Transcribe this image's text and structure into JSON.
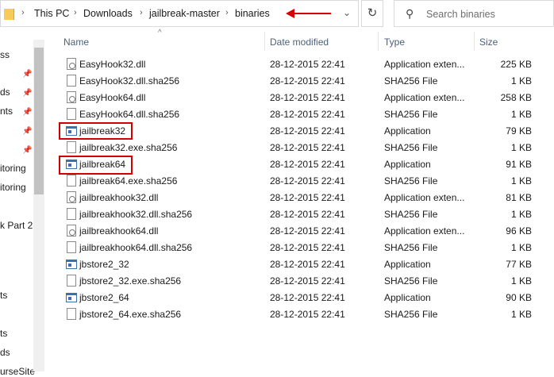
{
  "address": {
    "segments": [
      "This PC",
      "Downloads",
      "jailbreak-master",
      "binaries"
    ]
  },
  "search": {
    "placeholder": "Search binaries"
  },
  "nav": {
    "items": [
      "ss",
      "ds",
      "nts",
      "itoring",
      "itoring",
      "k Part 2",
      "ts",
      "ts",
      "ds",
      "urseSite"
    ]
  },
  "columns": {
    "name": "Name",
    "date": "Date modified",
    "type": "Type",
    "size": "Size"
  },
  "files": [
    {
      "name": "EasyHook32.dll",
      "date": "28-12-2015 22:41",
      "type": "Application exten...",
      "size": "225 KB",
      "icon": "dll"
    },
    {
      "name": "EasyHook32.dll.sha256",
      "date": "28-12-2015 22:41",
      "type": "SHA256 File",
      "size": "1 KB",
      "icon": "file"
    },
    {
      "name": "EasyHook64.dll",
      "date": "28-12-2015 22:41",
      "type": "Application exten...",
      "size": "258 KB",
      "icon": "dll"
    },
    {
      "name": "EasyHook64.dll.sha256",
      "date": "28-12-2015 22:41",
      "type": "SHA256 File",
      "size": "1 KB",
      "icon": "file"
    },
    {
      "name": "jailbreak32",
      "date": "28-12-2015 22:41",
      "type": "Application",
      "size": "79 KB",
      "icon": "app"
    },
    {
      "name": "jailbreak32.exe.sha256",
      "date": "28-12-2015 22:41",
      "type": "SHA256 File",
      "size": "1 KB",
      "icon": "file"
    },
    {
      "name": "jailbreak64",
      "date": "28-12-2015 22:41",
      "type": "Application",
      "size": "91 KB",
      "icon": "app"
    },
    {
      "name": "jailbreak64.exe.sha256",
      "date": "28-12-2015 22:41",
      "type": "SHA256 File",
      "size": "1 KB",
      "icon": "file"
    },
    {
      "name": "jailbreakhook32.dll",
      "date": "28-12-2015 22:41",
      "type": "Application exten...",
      "size": "81 KB",
      "icon": "dll"
    },
    {
      "name": "jailbreakhook32.dll.sha256",
      "date": "28-12-2015 22:41",
      "type": "SHA256 File",
      "size": "1 KB",
      "icon": "file"
    },
    {
      "name": "jailbreakhook64.dll",
      "date": "28-12-2015 22:41",
      "type": "Application exten...",
      "size": "96 KB",
      "icon": "dll"
    },
    {
      "name": "jailbreakhook64.dll.sha256",
      "date": "28-12-2015 22:41",
      "type": "SHA256 File",
      "size": "1 KB",
      "icon": "file"
    },
    {
      "name": "jbstore2_32",
      "date": "28-12-2015 22:41",
      "type": "Application",
      "size": "77 KB",
      "icon": "app"
    },
    {
      "name": "jbstore2_32.exe.sha256",
      "date": "28-12-2015 22:41",
      "type": "SHA256 File",
      "size": "1 KB",
      "icon": "file"
    },
    {
      "name": "jbstore2_64",
      "date": "28-12-2015 22:41",
      "type": "Application",
      "size": "90 KB",
      "icon": "app"
    },
    {
      "name": "jbstore2_64.exe.sha256",
      "date": "28-12-2015 22:41",
      "type": "SHA256 File",
      "size": "1 KB",
      "icon": "file"
    }
  ],
  "colors": {
    "highlight": "#d00000",
    "arrow": "#d60000",
    "header_text": "#4c607a"
  }
}
